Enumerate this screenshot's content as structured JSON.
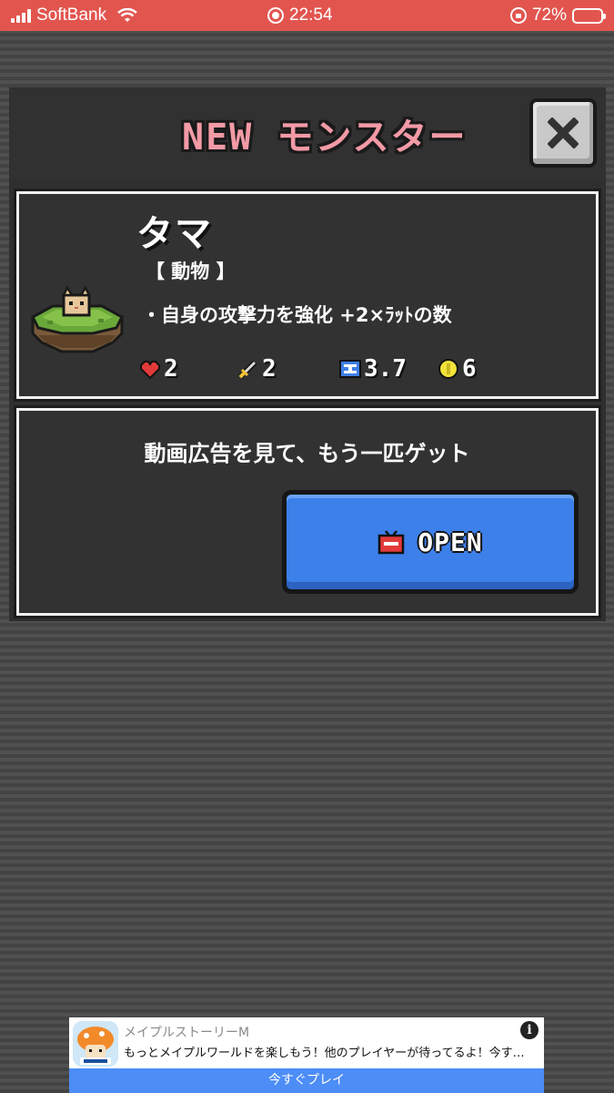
{
  "status_bar": {
    "carrier": "SoftBank",
    "time": "22:54",
    "battery_percent": "72%",
    "battery_level": 0.72
  },
  "dialog": {
    "title": "NEW モンスター",
    "close_icon": "close-x-icon"
  },
  "monster": {
    "name": "タマ",
    "category": "【 動物 】",
    "ability": "・自身の攻撃力を強化 +2×ﾗｯﾄの数",
    "sprite": "cat-on-grass-island",
    "stats": {
      "hp": "2",
      "attack": "2",
      "energy": "3.7",
      "coin": "6"
    },
    "colors": {
      "title_pink": "#f29aa6",
      "heart_red": "#e23a3a",
      "energy_blue": "#3f7fe6",
      "coin_yellow": "#f2e23a"
    }
  },
  "ad_offer": {
    "prompt": "動画広告を見て、もう一匹ゲット",
    "open_label": "OPEN",
    "button_color": "#3d80ea"
  },
  "banner_ad": {
    "app_name": "メイプルストーリーM",
    "body": "もっとメイプルワールドを楽しもう！他のプレイヤーが待ってるよ！今す…",
    "cta": "今すぐプレイ",
    "info_label": "i"
  }
}
